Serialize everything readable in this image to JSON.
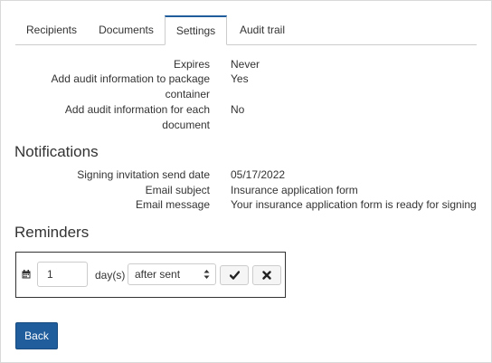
{
  "tabs": [
    {
      "label": "Recipients"
    },
    {
      "label": "Documents"
    },
    {
      "label": "Settings"
    },
    {
      "label": "Audit trail"
    }
  ],
  "active_tab": "Settings",
  "settings": {
    "expires_label": "Expires",
    "expires_value": "Never",
    "audit_package_label_1": "Add audit information to package",
    "audit_package_label_2": "container",
    "audit_package_value": "Yes",
    "audit_document_label_1": "Add audit information for each",
    "audit_document_label_2": "document",
    "audit_document_value": "No"
  },
  "notifications": {
    "heading": "Notifications",
    "send_date_label": "Signing invitation send date",
    "send_date_value": "05/17/2022",
    "subject_label": "Email subject",
    "subject_value": "Insurance application form",
    "message_label": "Email message",
    "message_value": "Your insurance application form is ready for signing"
  },
  "reminders": {
    "heading": "Reminders",
    "days_value": "1",
    "days_label": "day(s)",
    "when_selected": "after sent",
    "icons": {
      "calendar": "calendar-icon",
      "confirm": "check-icon",
      "cancel": "x-icon"
    }
  },
  "back_button": "Back",
  "colors": {
    "accent": "#1f5d9c",
    "border": "#cccccc",
    "text": "#333333"
  }
}
